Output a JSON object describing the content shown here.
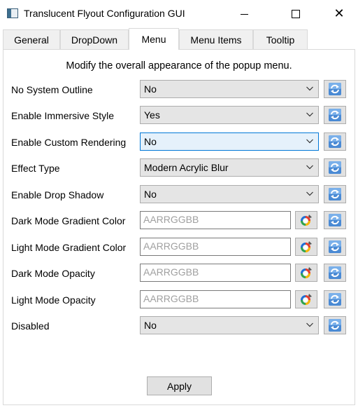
{
  "window": {
    "title": "Translucent Flyout Configuration GUI",
    "close_glyph": "✕"
  },
  "tabs": [
    {
      "label": "General"
    },
    {
      "label": "DropDown"
    },
    {
      "label": "Menu",
      "active": true
    },
    {
      "label": "Menu Items"
    },
    {
      "label": "Tooltip"
    }
  ],
  "panel": {
    "description": "Modify the overall appearance of the popup menu."
  },
  "settings": {
    "no_system_outline": {
      "label": "No System Outline",
      "value": "No"
    },
    "enable_immersive_style": {
      "label": "Enable Immersive Style",
      "value": "Yes"
    },
    "enable_custom_rendering": {
      "label": "Enable Custom Rendering",
      "value": "No"
    },
    "effect_type": {
      "label": "Effect Type",
      "value": "Modern Acrylic Blur"
    },
    "enable_drop_shadow": {
      "label": "Enable Drop Shadow",
      "value": "No"
    },
    "dark_mode_gradient_color": {
      "label": "Dark Mode Gradient Color",
      "placeholder": "AARRGGBB"
    },
    "light_mode_gradient_color": {
      "label": "Light Mode Gradient Color",
      "placeholder": "AARRGGBB"
    },
    "dark_mode_opacity": {
      "label": "Dark Mode Opacity",
      "placeholder": "AARRGGBB"
    },
    "light_mode_opacity": {
      "label": "Light Mode Opacity",
      "placeholder": "AARRGGBB"
    },
    "disabled": {
      "label": "Disabled",
      "value": "No"
    }
  },
  "footer": {
    "apply_label": "Apply"
  },
  "icons": {
    "reset": "refresh-icon",
    "color": "color-wheel-icon",
    "dropdown": "chevron-down-icon"
  },
  "colors": {
    "focus_border": "#0078d7",
    "focus_fill": "#e5f1fb",
    "combo_fill": "#e5e5e5",
    "button_fill": "#e1e1e1"
  }
}
